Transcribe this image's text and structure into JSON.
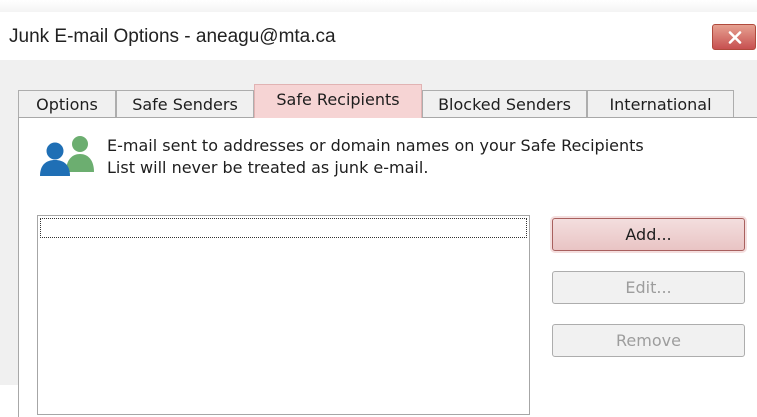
{
  "window": {
    "title": "Junk E-mail Options - aneagu@mta.ca",
    "close_icon": "close-icon"
  },
  "tabs": [
    {
      "label": "Options",
      "active": false
    },
    {
      "label": "Safe Senders",
      "active": false
    },
    {
      "label": "Safe Recipients",
      "active": true
    },
    {
      "label": "Blocked Senders",
      "active": false
    },
    {
      "label": "International",
      "active": false
    }
  ],
  "panel": {
    "icon": "people-icon",
    "info_line1": "E-mail sent to addresses or domain names on your Safe Recipients",
    "info_line2": "List will never be treated as junk e-mail.",
    "list_items": []
  },
  "buttons": {
    "add": "Add...",
    "edit": "Edit...",
    "remove": "Remove"
  },
  "colors": {
    "active_tab": "#f6d4d4",
    "close_button": "#c75050",
    "people_icon_blue": "#1f6fb5",
    "people_icon_green": "#6cae70"
  }
}
